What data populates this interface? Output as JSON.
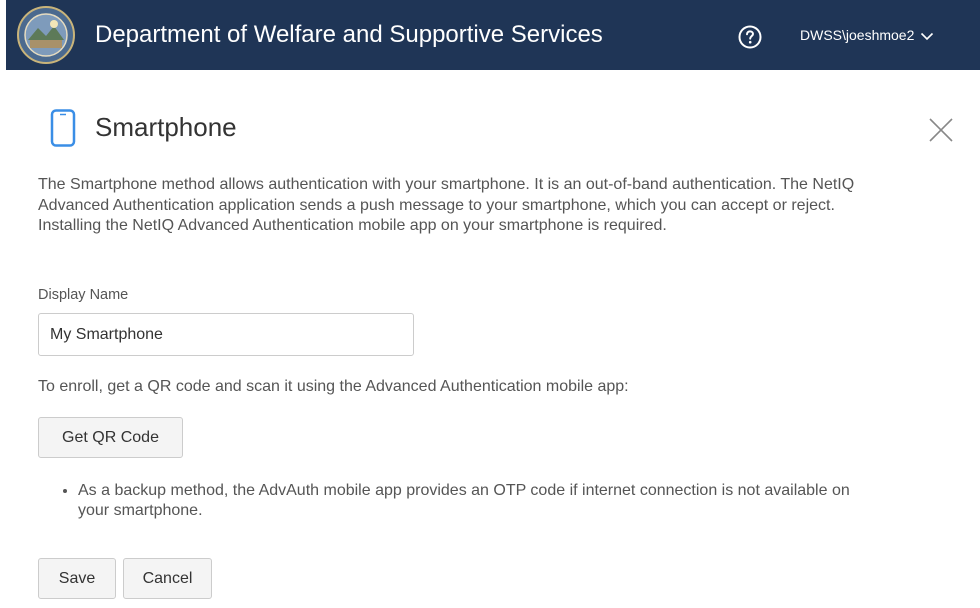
{
  "header": {
    "title": "Department of Welfare and Supportive Services",
    "user": "DWSS\\joeshmoe2",
    "background_color": "#1f3556",
    "seal_icon": "state-seal-logo",
    "help_icon": "question-circle-icon",
    "user_menu_icon": "chevron-down-icon"
  },
  "page": {
    "title": "Smartphone",
    "title_icon": "smartphone-icon",
    "icon_color": "#3a8ee6",
    "close_icon": "close-x-icon",
    "description": "The Smartphone method allows authentication with your smartphone. It is an out-of-band authentication. The NetIQ Advanced Authentication application sends a push message to your smartphone, which you can accept or reject. Installing the NetIQ Advanced Authentication mobile app on your smartphone is required."
  },
  "form": {
    "display_name_label": "Display Name",
    "display_name_value": "My Smartphone",
    "enroll_text": "To enroll, get a QR code and scan it using the Advanced Authentication mobile app:",
    "qr_button_label": "Get QR Code",
    "notes": [
      "As a backup method, the AdvAuth mobile app provides an OTP code if internet connection is not available on your smartphone."
    ],
    "save_label": "Save",
    "cancel_label": "Cancel"
  }
}
